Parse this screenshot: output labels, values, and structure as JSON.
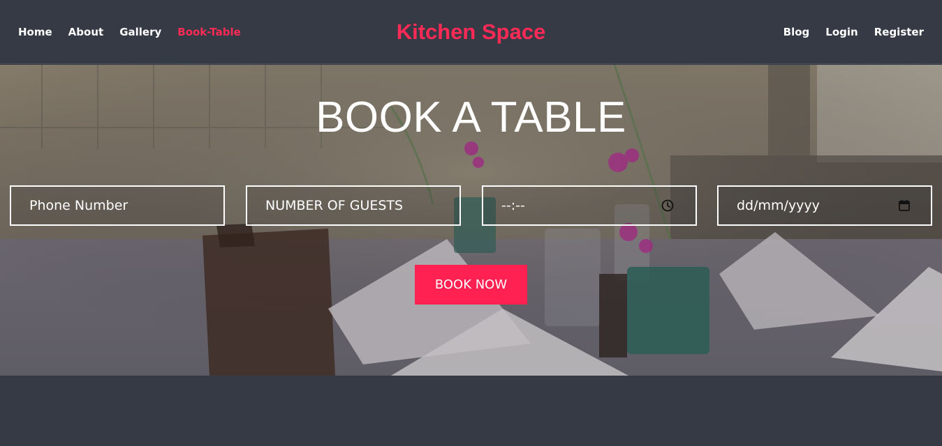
{
  "nav": {
    "left": [
      "Home",
      "About",
      "Gallery",
      "Book-Table"
    ],
    "active": "Book-Table",
    "right": [
      "Blog",
      "Login",
      "Register"
    ]
  },
  "brand": "Kitchen Space",
  "hero": {
    "title": "BOOK A TABLE",
    "phone_placeholder": "Phone Number",
    "guests_placeholder": "NUMBER OF GUESTS",
    "time_value": "--:--",
    "date_value": "dd/mm/yyyy",
    "button": "BOOK NOW"
  },
  "colors": {
    "accent": "#ff2a55",
    "background": "#353a45",
    "button": "#ff2151"
  },
  "icons": [
    "clock-icon",
    "calendar-icon"
  ]
}
